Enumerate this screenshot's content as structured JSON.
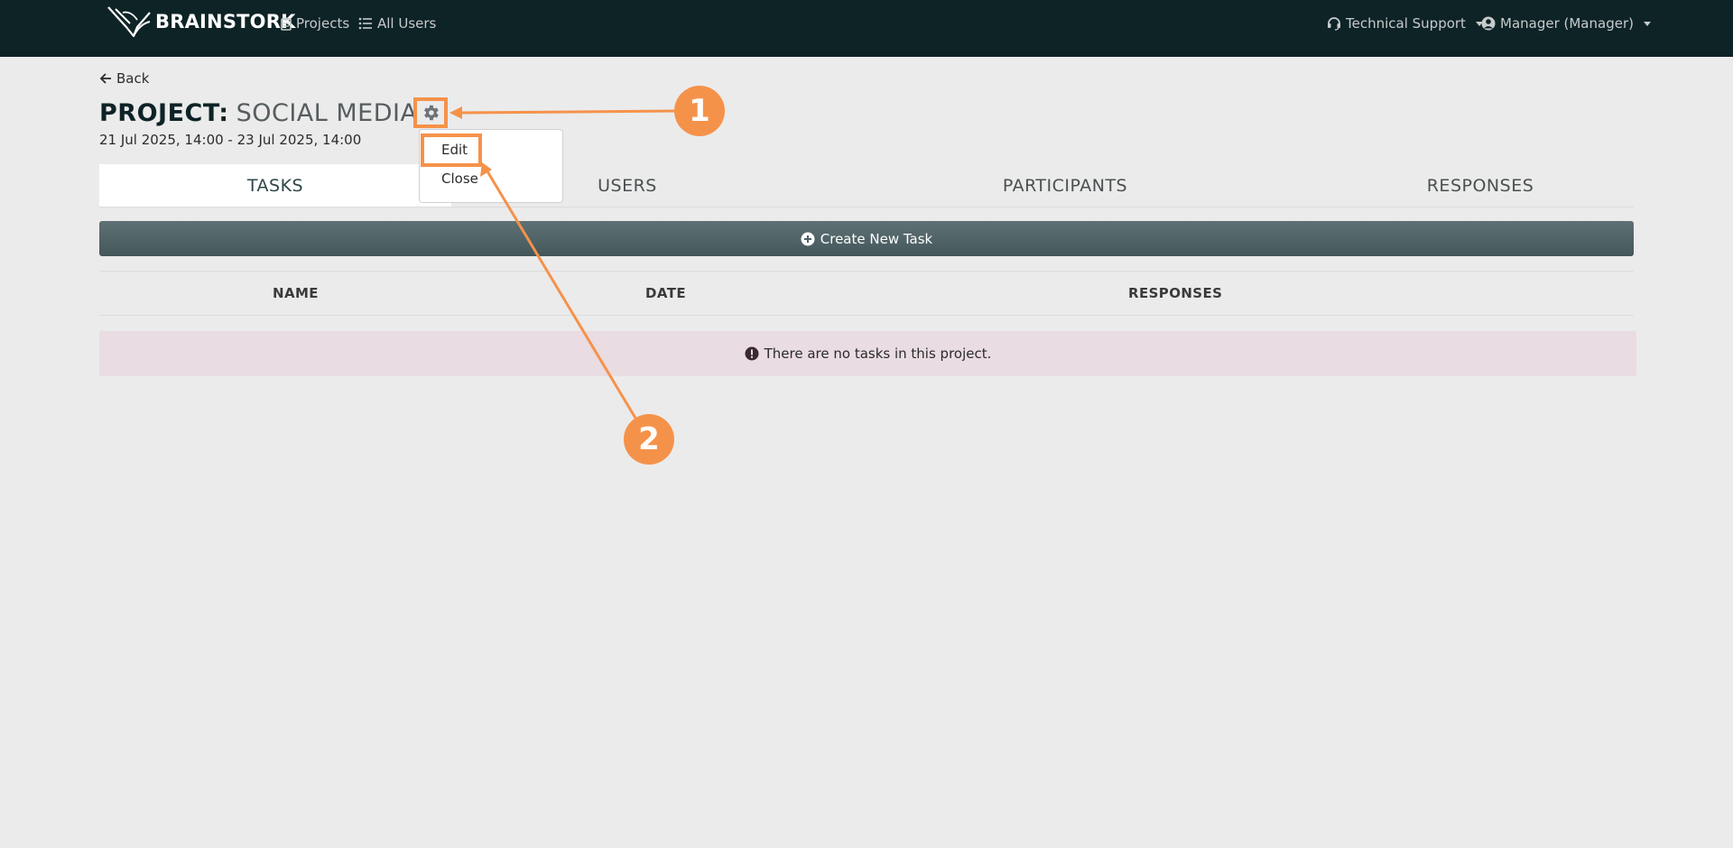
{
  "navbar": {
    "brand": "BRAINSTORK",
    "projects": "Projects",
    "all_users": "All Users",
    "technical_support": "Technical Support",
    "user_menu": "Manager (Manager)"
  },
  "page": {
    "back": "Back",
    "title_label": "PROJECT:",
    "title_name": "SOCIAL MEDIA",
    "date_range": "21 Jul 2025, 14:00 - 23 Jul 2025, 14:00"
  },
  "dropdown": {
    "edit": "Edit",
    "close": "Close"
  },
  "tabs": [
    {
      "label": "TASKS",
      "active": true
    },
    {
      "label": "USERS",
      "active": false
    },
    {
      "label": "PARTICIPANTS",
      "active": false
    },
    {
      "label": "RESPONSES",
      "active": false
    }
  ],
  "actions": {
    "create_task": "Create New Task"
  },
  "table": {
    "columns": [
      "NAME",
      "DATE",
      "RESPONSES"
    ]
  },
  "empty_message": "There are no tasks in this project.",
  "annotations": {
    "callout_1": "1",
    "callout_2": "2",
    "accent_color": "#f5924a"
  }
}
